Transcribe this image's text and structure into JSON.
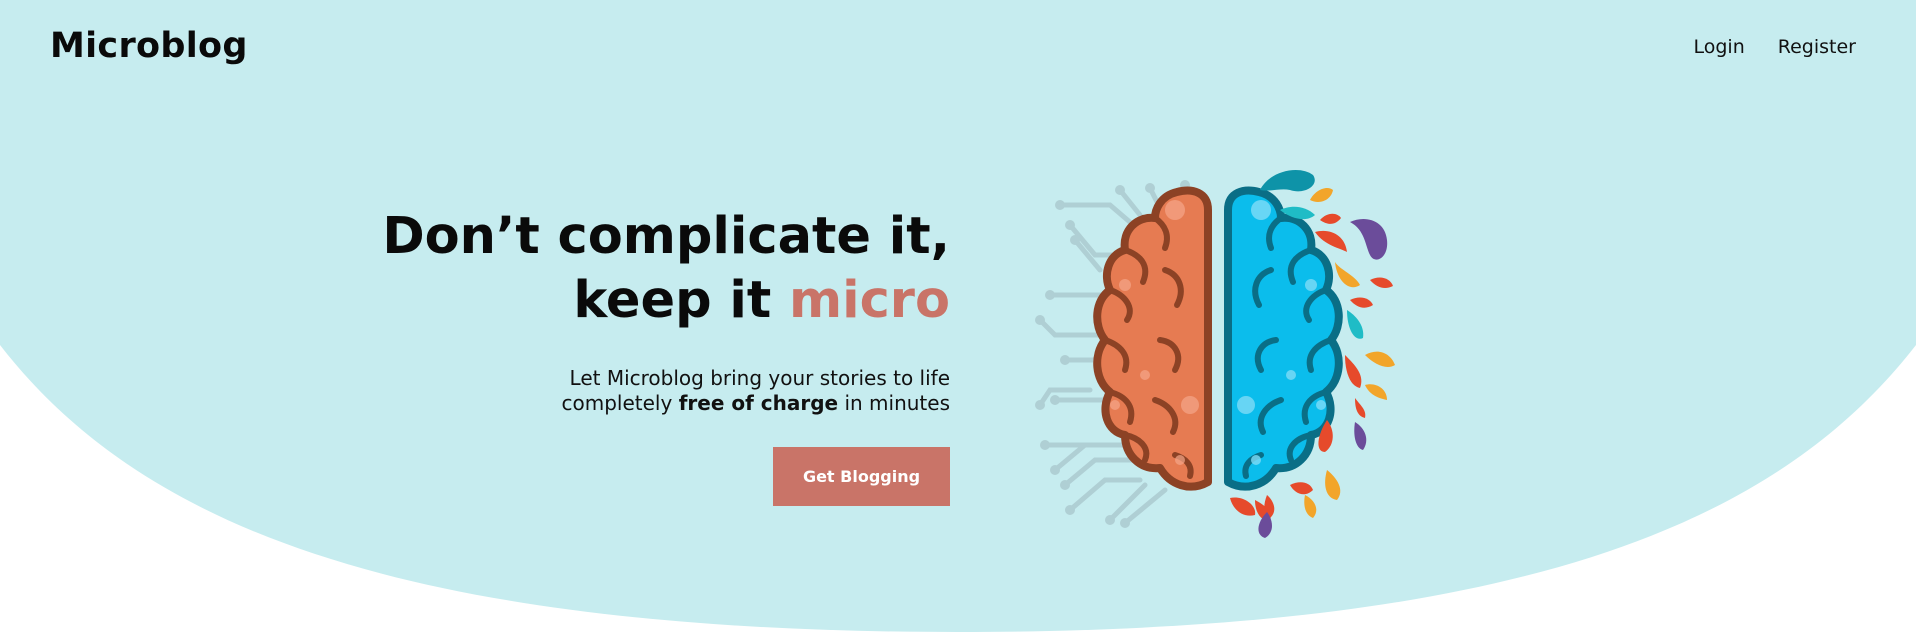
{
  "colors": {
    "hero_background": "#c6ecef",
    "accent": "#c97468",
    "brain_left": "#e67b52",
    "brain_left_outline": "#8c4225",
    "brain_right": "#0bbdec",
    "brain_right_outline": "#0a6e86",
    "circuit": "#afcfd4"
  },
  "header": {
    "brand": "Microblog",
    "nav": {
      "login": "Login",
      "register": "Register"
    }
  },
  "hero": {
    "headline_line1": "Don’t complicate it,",
    "headline_line2_prefix": "keep it ",
    "headline_accent": "micro",
    "subtext_line1": "Let Microblog bring your stories to life",
    "subtext_line2_prefix": "completely ",
    "subtext_bold": "free of charge",
    "subtext_line2_suffix": " in minutes",
    "cta_label": "Get Blogging"
  },
  "illustration": {
    "icon": "brain-icon"
  }
}
